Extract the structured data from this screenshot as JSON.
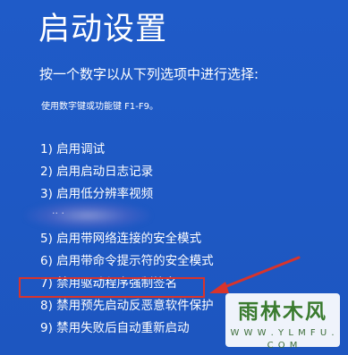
{
  "screen": {
    "title": "启动设置",
    "subtitle": "按一个数字以从下列选项中进行选择:",
    "hint": "使用数字键或功能键 F1-F9。"
  },
  "options": [
    {
      "label": "1) 启用调试"
    },
    {
      "label": "2) 启用启动日志记录"
    },
    {
      "label": "3) 启用低分辨率视频"
    },
    {
      "label": ""
    },
    {
      "label": "5) 启用带网络连接的安全模式"
    },
    {
      "label": "6) 启用带命令提示符的安全模式"
    },
    {
      "label": "7) 禁用驱动程序强制签名"
    },
    {
      "label": "8) 禁用预先启动反恶意软件保护"
    },
    {
      "label": "9) 禁用失败后自动重新启动"
    }
  ],
  "highlight": {
    "color": "#d8342c",
    "target_option": "7) 禁用驱动程序强制签名"
  },
  "watermark": {
    "name": "雨林木风",
    "url": "W W W . Y L M F U . C O M"
  },
  "colors": {
    "background": "#1f5bc8",
    "text": "#ffffff",
    "highlight": "#d8342c"
  }
}
